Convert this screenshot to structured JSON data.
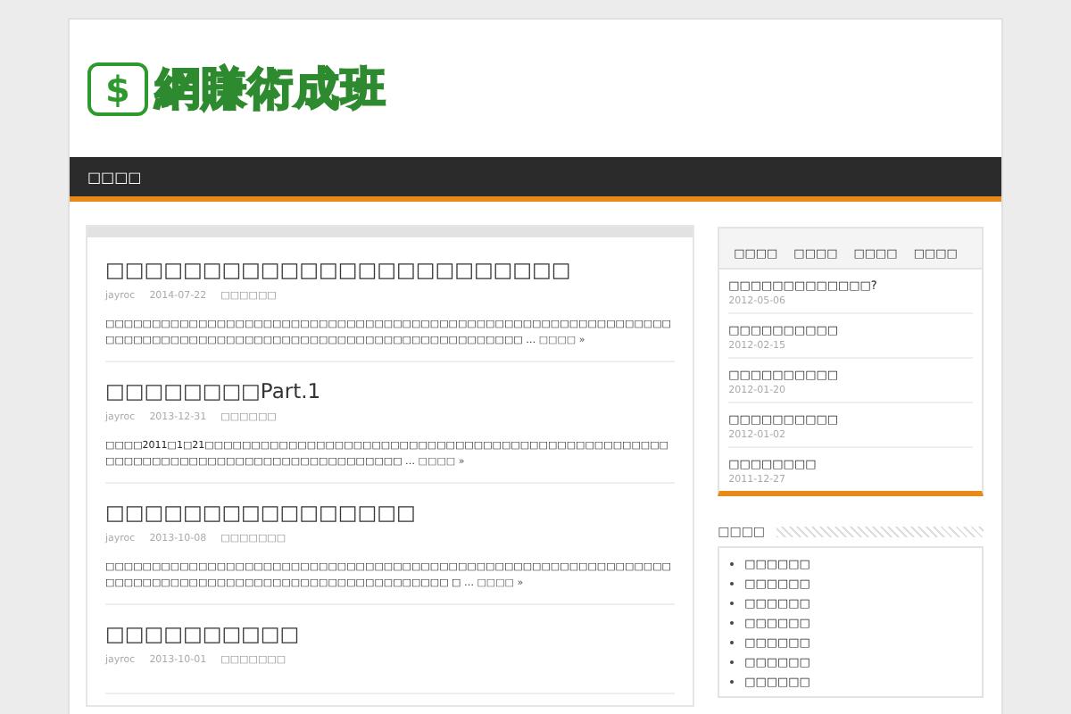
{
  "header": {
    "logo_icon": "$",
    "logo_text": "網賺術成班"
  },
  "nav": {
    "items": [
      {
        "label": "□□□□",
        "selected": false
      }
    ]
  },
  "posts": [
    {
      "title": "□□□□□□□□□□□□□□□□□□□□□□□□",
      "author": "jayroc",
      "date": "2014-07-22",
      "category": "□□□□□□",
      "excerpt": "□□□□□□□□□□□□□□□□□□□□□□□□□□□□□□□□□□□□□□□□□□□□□□□□□□□□□□□□□□□□□□□□□□□□□□□□□□□□□□□□□□□□□□□□□□□□□□□□□□□□□□□□□□ …",
      "more": "□□□□ »"
    },
    {
      "title": "□□□□□□□□Part.1",
      "author": "jayroc",
      "date": "2013-12-31",
      "category": "□□□□□□",
      "excerpt": "□□□□2011□1□21□□□□□□□□□□□□□□□□□□□□□□□□□□□□□□□□□□□□□□□□□□□□□□□□□□□□□□□□□□□□□□□□□□□□□□□□□□□□□□□□□□ …",
      "more": "□□□□ »"
    },
    {
      "title": "□□□□□□□□□□□□□□□□",
      "author": "jayroc",
      "date": "2013-10-08",
      "category": "□□□□□□□",
      "excerpt": "□□□□□□□□□□□□□□□□□□□□□□□□□□□□□□□□□□□□□□□□□□□□□□□□□□□□□□□□□□□□□□□□□□□□□□□□□□□□□□□□□□□□□□□□□□□□□□□□□□ □ …",
      "more": "□□□□ »"
    },
    {
      "title": "□□□□□□□□□□",
      "author": "jayroc",
      "date": "2013-10-01",
      "category": "□□□□□□□"
    }
  ],
  "sidebar": {
    "tabs": [
      {
        "label": "□□□□",
        "selected": false
      },
      {
        "label": "□□□□",
        "selected": false
      },
      {
        "label": "□□□□",
        "selected": false
      },
      {
        "label": "□□□□",
        "selected": false
      }
    ],
    "tab_items": [
      {
        "title": "□□□□□□□□□□□□□?",
        "date": "2012-05-06"
      },
      {
        "title": "□□□□□□□□□□",
        "date": "2012-02-15"
      },
      {
        "title": "□□□□□□□□□□",
        "date": "2012-01-20"
      },
      {
        "title": "□□□□□□□□□□",
        "date": "2012-01-02"
      },
      {
        "title": "□□□□□□□□",
        "date": "2011-12-27"
      }
    ],
    "widget_title": "□□□□",
    "categories": [
      "□□□□□□",
      "□□□□□□",
      "□□□□□□",
      "□□□□□□",
      "□□□□□□",
      "□□□□□□",
      "□□□□□□"
    ]
  }
}
